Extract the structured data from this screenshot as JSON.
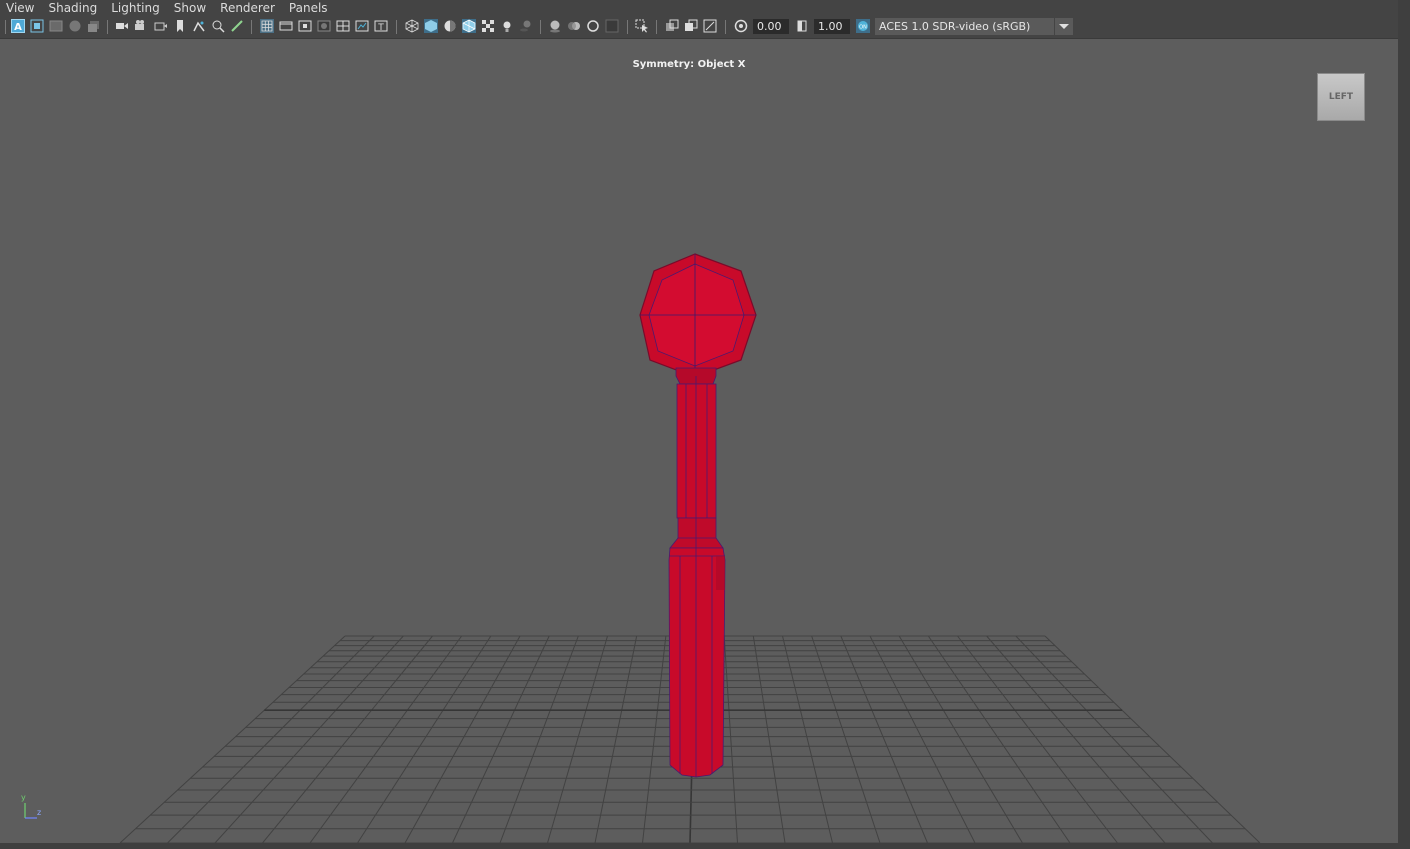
{
  "menubar": {
    "items": [
      "View",
      "Shading",
      "Lighting",
      "Show",
      "Renderer",
      "Panels"
    ]
  },
  "toolbar": {
    "exposure_value": "0.00",
    "gamma_value": "1.00",
    "color_management_badge": "ON",
    "color_space": "ACES 1.0 SDR-video (sRGB)",
    "icons": [
      "select-camera-icon",
      "camera-attributes-icon",
      "bookmark-icon",
      "image-plane-icon",
      "grid-icon",
      "film-gate-icon",
      "resolution-gate-icon",
      "gate-mask-icon",
      "field-chart-icon",
      "safe-action-icon",
      "safe-title-icon",
      "wireframe-icon",
      "smooth-shade-icon",
      "default-material-icon",
      "wireframe-on-shaded-icon",
      "textured-icon",
      "use-all-lights-icon",
      "shadows-icon",
      "screen-space-ao-icon",
      "motion-blur-icon",
      "anti-aliasing-icon",
      "depth-of-field-icon",
      "isolate-select-icon",
      "xray-icon",
      "xray-joints-icon",
      "xray-components-icon",
      "exposure-icon",
      "gamma-icon",
      "color-management-icon",
      "dropdown-arrow-icon"
    ]
  },
  "viewport": {
    "symmetry_label": "Symmetry: Object X",
    "viewcube_label": "LEFT",
    "axis_y": "y",
    "axis_z": "z"
  },
  "colors": {
    "panel_bg": "#444444",
    "viewport_bg": "#5d5d5d",
    "model_fill": "#c80a2a",
    "model_edge": "#3a1a6e",
    "grid_line": "#3f3f3f",
    "accent": "#4fb3d9"
  }
}
